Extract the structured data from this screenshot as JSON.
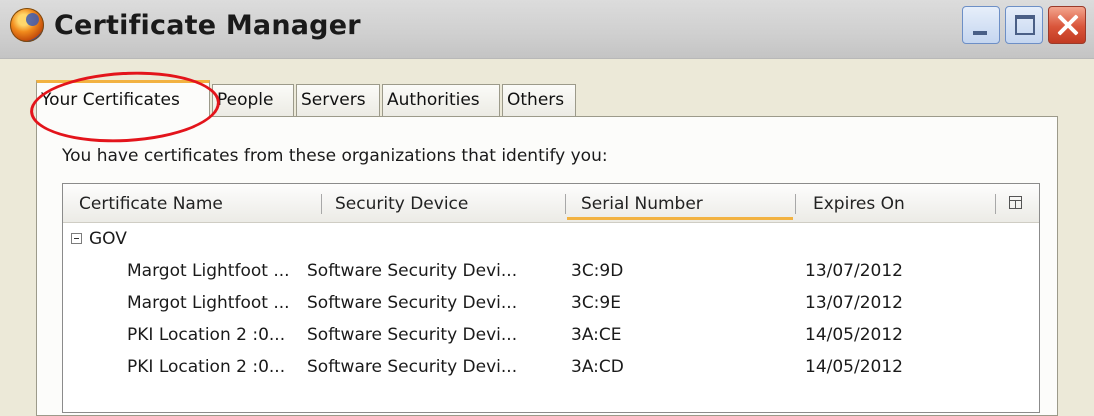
{
  "window": {
    "title": "Certificate Manager"
  },
  "tabs": [
    {
      "label": "Your Certificates",
      "active": true
    },
    {
      "label": "People",
      "active": false
    },
    {
      "label": "Servers",
      "active": false
    },
    {
      "label": "Authorities",
      "active": false
    },
    {
      "label": "Others",
      "active": false
    }
  ],
  "panel": {
    "intro": "You have certificates from these organizations that identify you:"
  },
  "table": {
    "columns": [
      "Certificate Name",
      "Security Device",
      "Serial Number",
      "Expires On"
    ],
    "sorted_column": "Serial Number",
    "groups": [
      {
        "name": "GOV",
        "expanded": true,
        "rows": [
          {
            "name": "Margot Lightfoot ...",
            "device": "Software Security Devi...",
            "serial": "3C:9D",
            "expires": "13/07/2012"
          },
          {
            "name": "Margot Lightfoot ...",
            "device": "Software Security Devi...",
            "serial": "3C:9E",
            "expires": "13/07/2012"
          },
          {
            "name": "PKI Location 2 :0...",
            "device": "Software Security Devi...",
            "serial": "3A:CE",
            "expires": "14/05/2012"
          },
          {
            "name": "PKI Location 2 :0...",
            "device": "Software Security Devi...",
            "serial": "3A:CD",
            "expires": "14/05/2012"
          }
        ]
      }
    ]
  },
  "colors": {
    "highlight": "#e3141b",
    "tab_accent": "#f2b241",
    "background": "#ece9d8"
  },
  "icons": {
    "app": "firefox-icon",
    "minimize": "minimize-icon",
    "maximize": "maximize-icon",
    "close": "close-icon",
    "collapse": "minus-box-icon",
    "column_picker": "column-picker-icon"
  }
}
